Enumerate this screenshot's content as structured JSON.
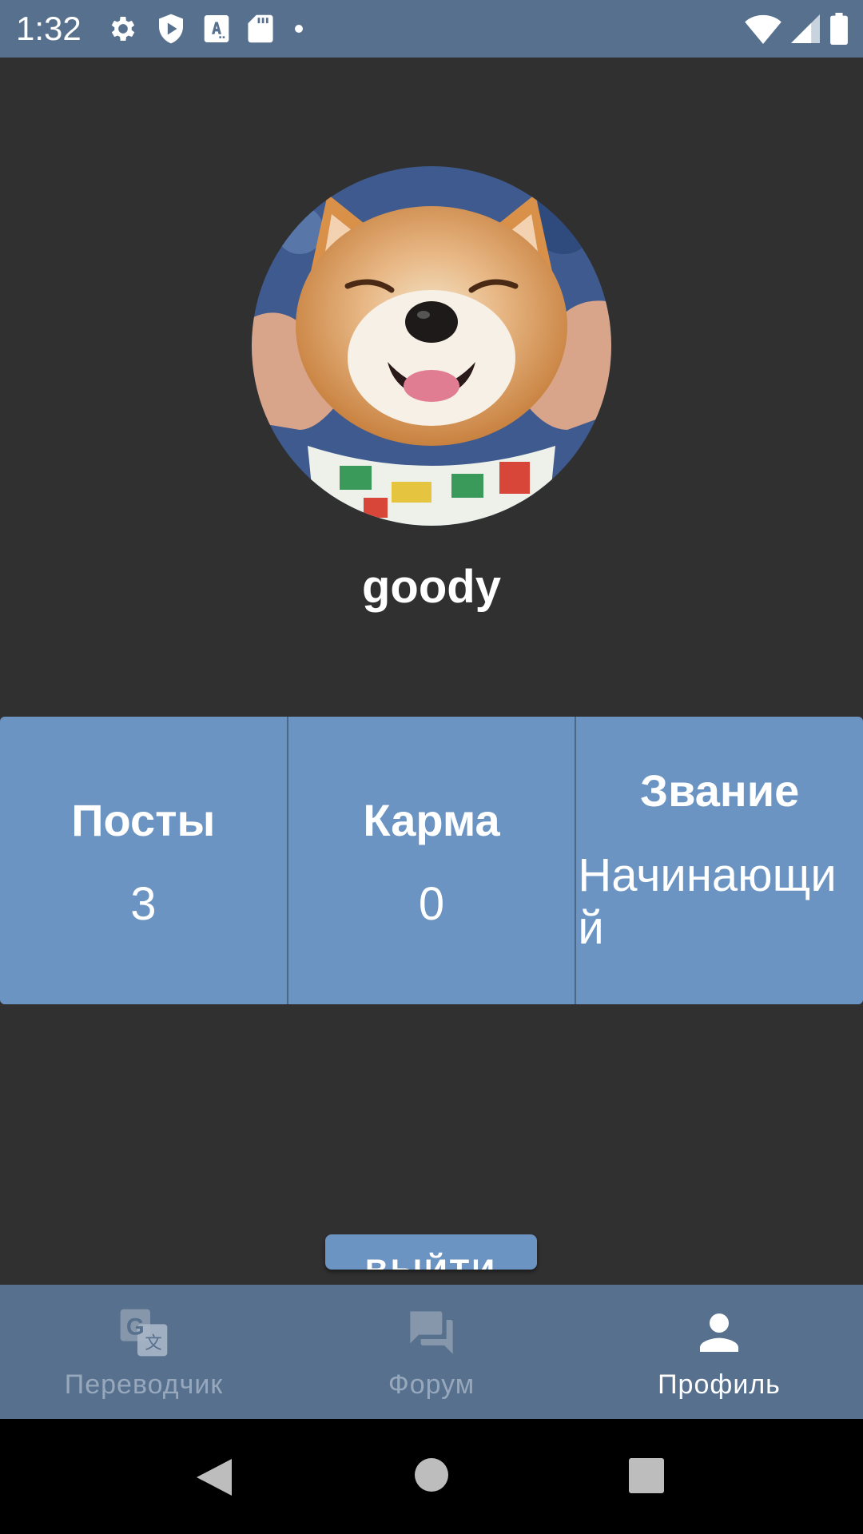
{
  "status_bar": {
    "time": "1:32",
    "icons_left": [
      "settings-icon",
      "shield-play-icon",
      "text-format-icon",
      "sd-card-icon",
      "dot-icon"
    ],
    "icons_right": [
      "wifi-icon",
      "cell-signal-icon",
      "battery-icon"
    ]
  },
  "profile": {
    "username": "goody",
    "avatar": "avatar-dog-photo"
  },
  "stats": {
    "posts_title": "Посты",
    "posts_value": "3",
    "karma_title": "Карма",
    "karma_value": "0",
    "rank_title": "Звание",
    "rank_value": "Начинающий"
  },
  "logout_label": "ВЫЙТИ",
  "bottom_nav": {
    "items": [
      {
        "label": "Переводчик",
        "icon": "translate-icon",
        "active": false
      },
      {
        "label": "Форум",
        "icon": "forum-icon",
        "active": false
      },
      {
        "label": "Профиль",
        "icon": "person-icon",
        "active": true
      }
    ]
  },
  "colors": {
    "background": "#303030",
    "accent": "#6b94c3",
    "bar": "#56708d"
  }
}
